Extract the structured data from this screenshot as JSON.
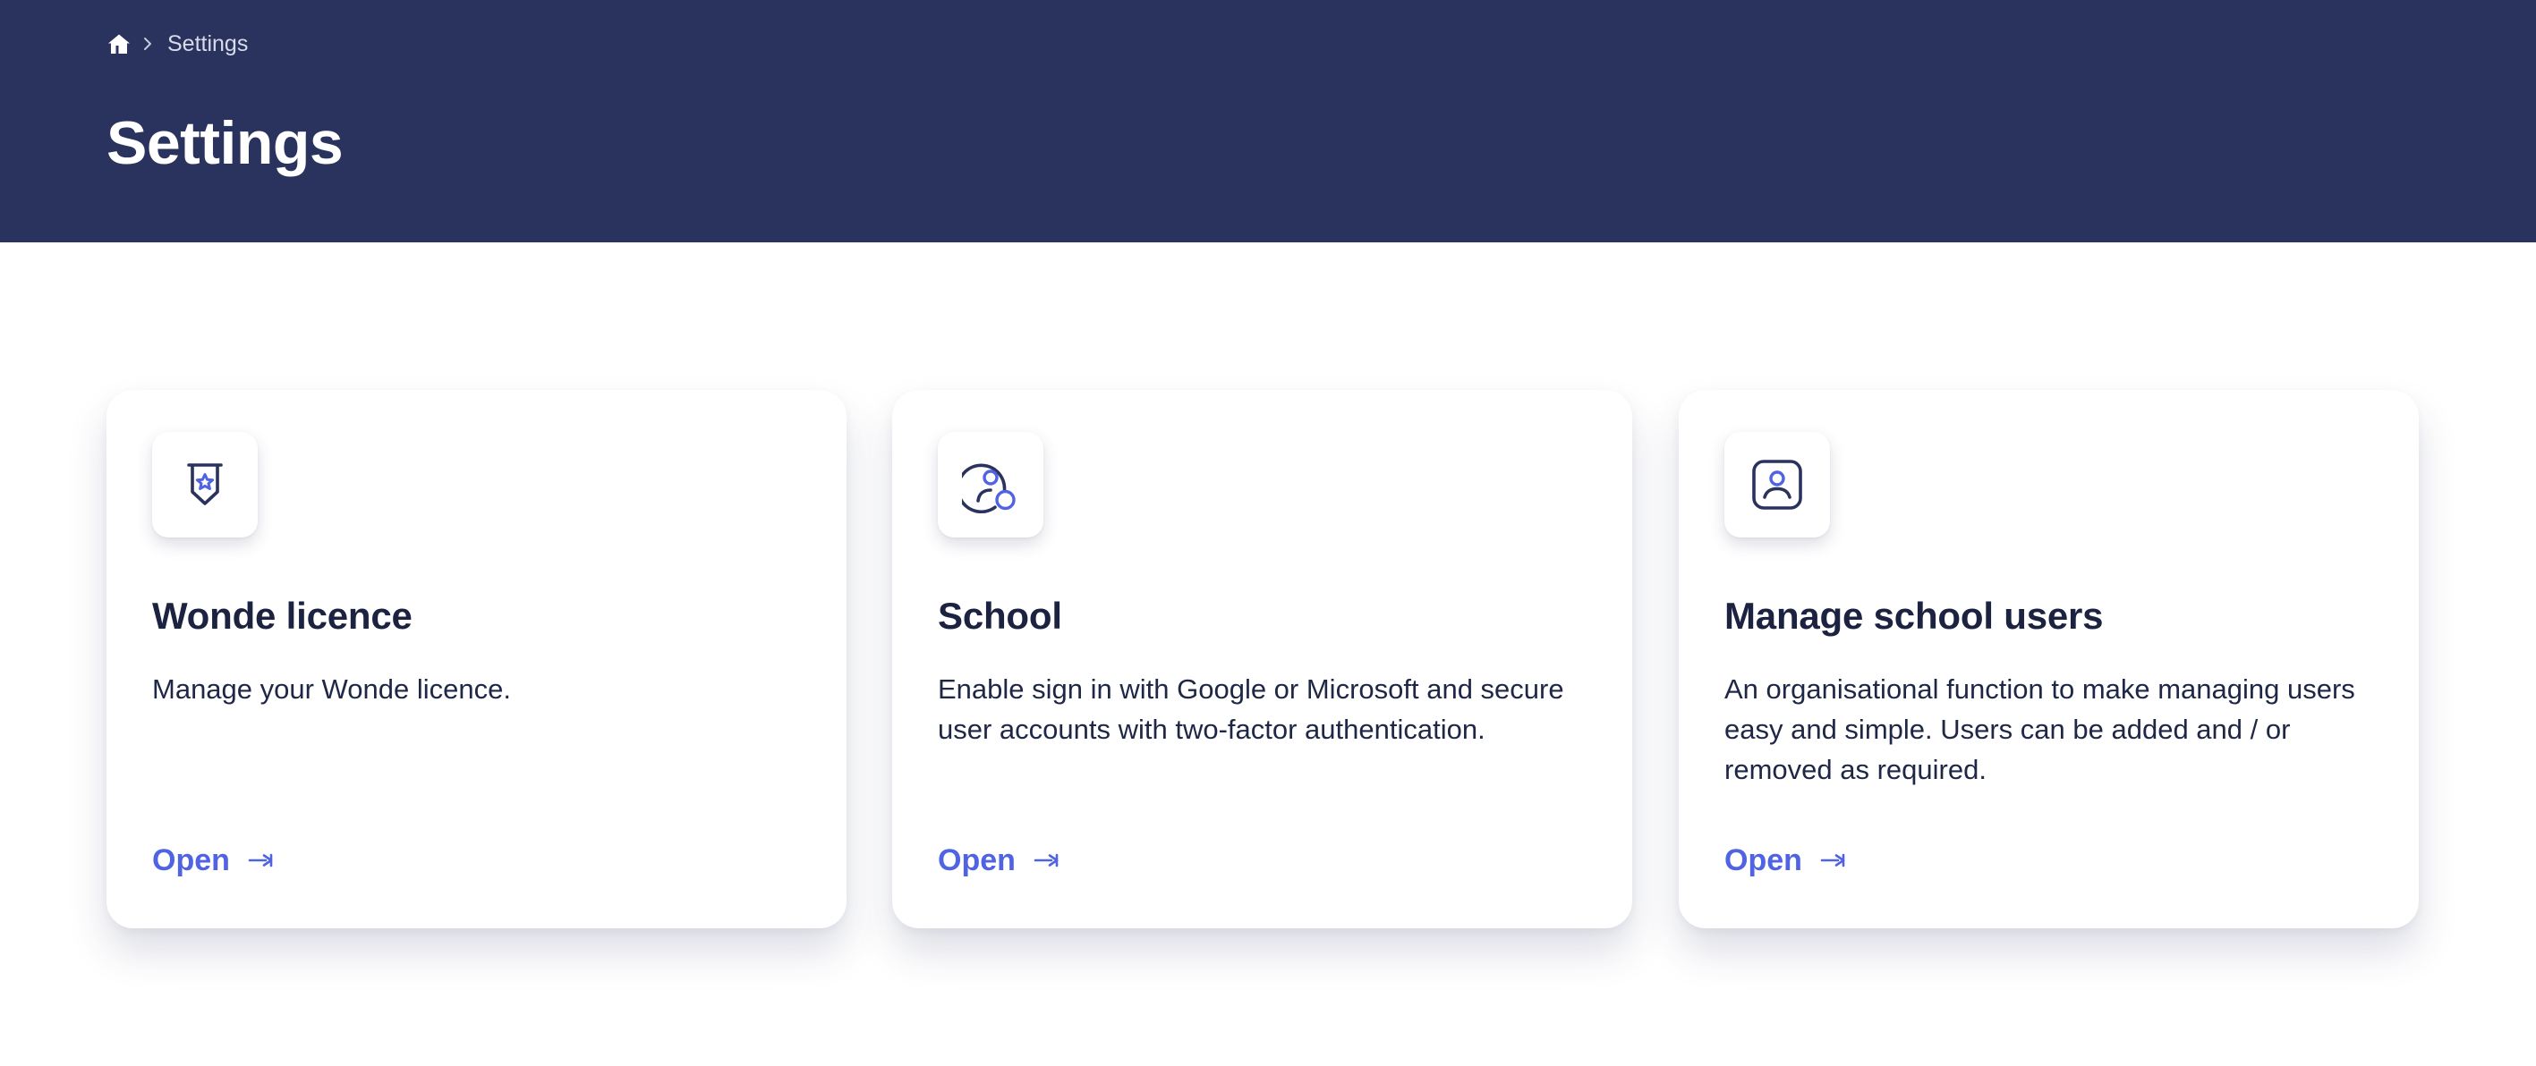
{
  "breadcrumb": {
    "home_icon": "home-icon",
    "separator_icon": "chevron-right-icon",
    "current": "Settings"
  },
  "page": {
    "title": "Settings"
  },
  "colors": {
    "header_bg": "#2a335d",
    "accent": "#4f63e3",
    "icon_dark": "#2a335d",
    "text_dark": "#1c2340"
  },
  "cards": [
    {
      "icon": "licence-badge-icon",
      "title": "Wonde licence",
      "description": "Manage your Wonde licence.",
      "action_label": "Open",
      "action_icon": "arrow-right-icon"
    },
    {
      "icon": "school-user-icon",
      "title": "School",
      "description": "Enable sign in with Google or Microsoft and secure user accounts with two-factor authentication.",
      "action_label": "Open",
      "action_icon": "arrow-right-icon"
    },
    {
      "icon": "user-frame-icon",
      "title": "Manage school users",
      "description": "An organisational function to make managing users easy and simple. Users can be added and / or removed as required.",
      "action_label": "Open",
      "action_icon": "arrow-right-icon"
    }
  ]
}
